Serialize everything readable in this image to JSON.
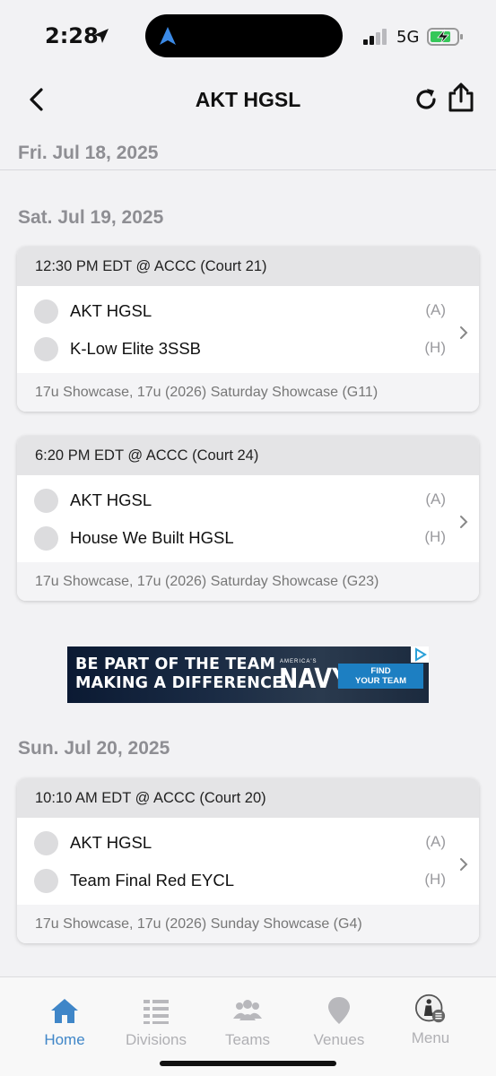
{
  "status_bar": {
    "time": "2:28",
    "network": "5G"
  },
  "nav": {
    "title": "AKT HGSL"
  },
  "sticky_day": "Fri. Jul 18, 2025",
  "days": [
    {
      "date": "Sat. Jul 19, 2025",
      "games": [
        {
          "header": "12:30 PM EDT @ ACCC (Court 21)",
          "teams": [
            {
              "name": "AKT HGSL",
              "side": "(A)"
            },
            {
              "name": "K-Low Elite 3SSB",
              "side": "(H)"
            }
          ],
          "footer": "17u Showcase, 17u (2026) Saturday Showcase (G11)"
        },
        {
          "header": "6:20 PM EDT @ ACCC (Court 24)",
          "teams": [
            {
              "name": "AKT HGSL",
              "side": "(A)"
            },
            {
              "name": "House We Built HGSL",
              "side": "(H)"
            }
          ],
          "footer": "17u Showcase, 17u (2026) Saturday Showcase (G23)"
        }
      ]
    },
    {
      "date": "Sun. Jul 20, 2025",
      "games": [
        {
          "header": "10:10 AM EDT @ ACCC (Court 20)",
          "teams": [
            {
              "name": "AKT HGSL",
              "side": "(A)"
            },
            {
              "name": "Team Final Red EYCL",
              "side": "(H)"
            }
          ],
          "footer": "17u Showcase, 17u (2026) Sunday Showcase (G4)"
        }
      ]
    }
  ],
  "ad": {
    "headline_1": "BE PART OF THE TEAM",
    "headline_2": "MAKING A DIFFERENCE.",
    "brand_small": "AMERICA'S",
    "brand": "NAVY",
    "cta_1": "FIND",
    "cta_2": "YOUR TEAM"
  },
  "tabs": [
    {
      "label": "Home",
      "icon": "home-icon",
      "active": true
    },
    {
      "label": "Divisions",
      "icon": "list-icon",
      "active": false
    },
    {
      "label": "Teams",
      "icon": "people-icon",
      "active": false
    },
    {
      "label": "Venues",
      "icon": "map-pin-icon",
      "active": false
    },
    {
      "label": "Menu",
      "icon": "menu-avatar-icon",
      "active": false
    }
  ],
  "colors": {
    "accent": "#3f86c8",
    "inactive": "#b0b0b4",
    "card_header": "#e4e4e6",
    "background": "#f2f2f4"
  }
}
